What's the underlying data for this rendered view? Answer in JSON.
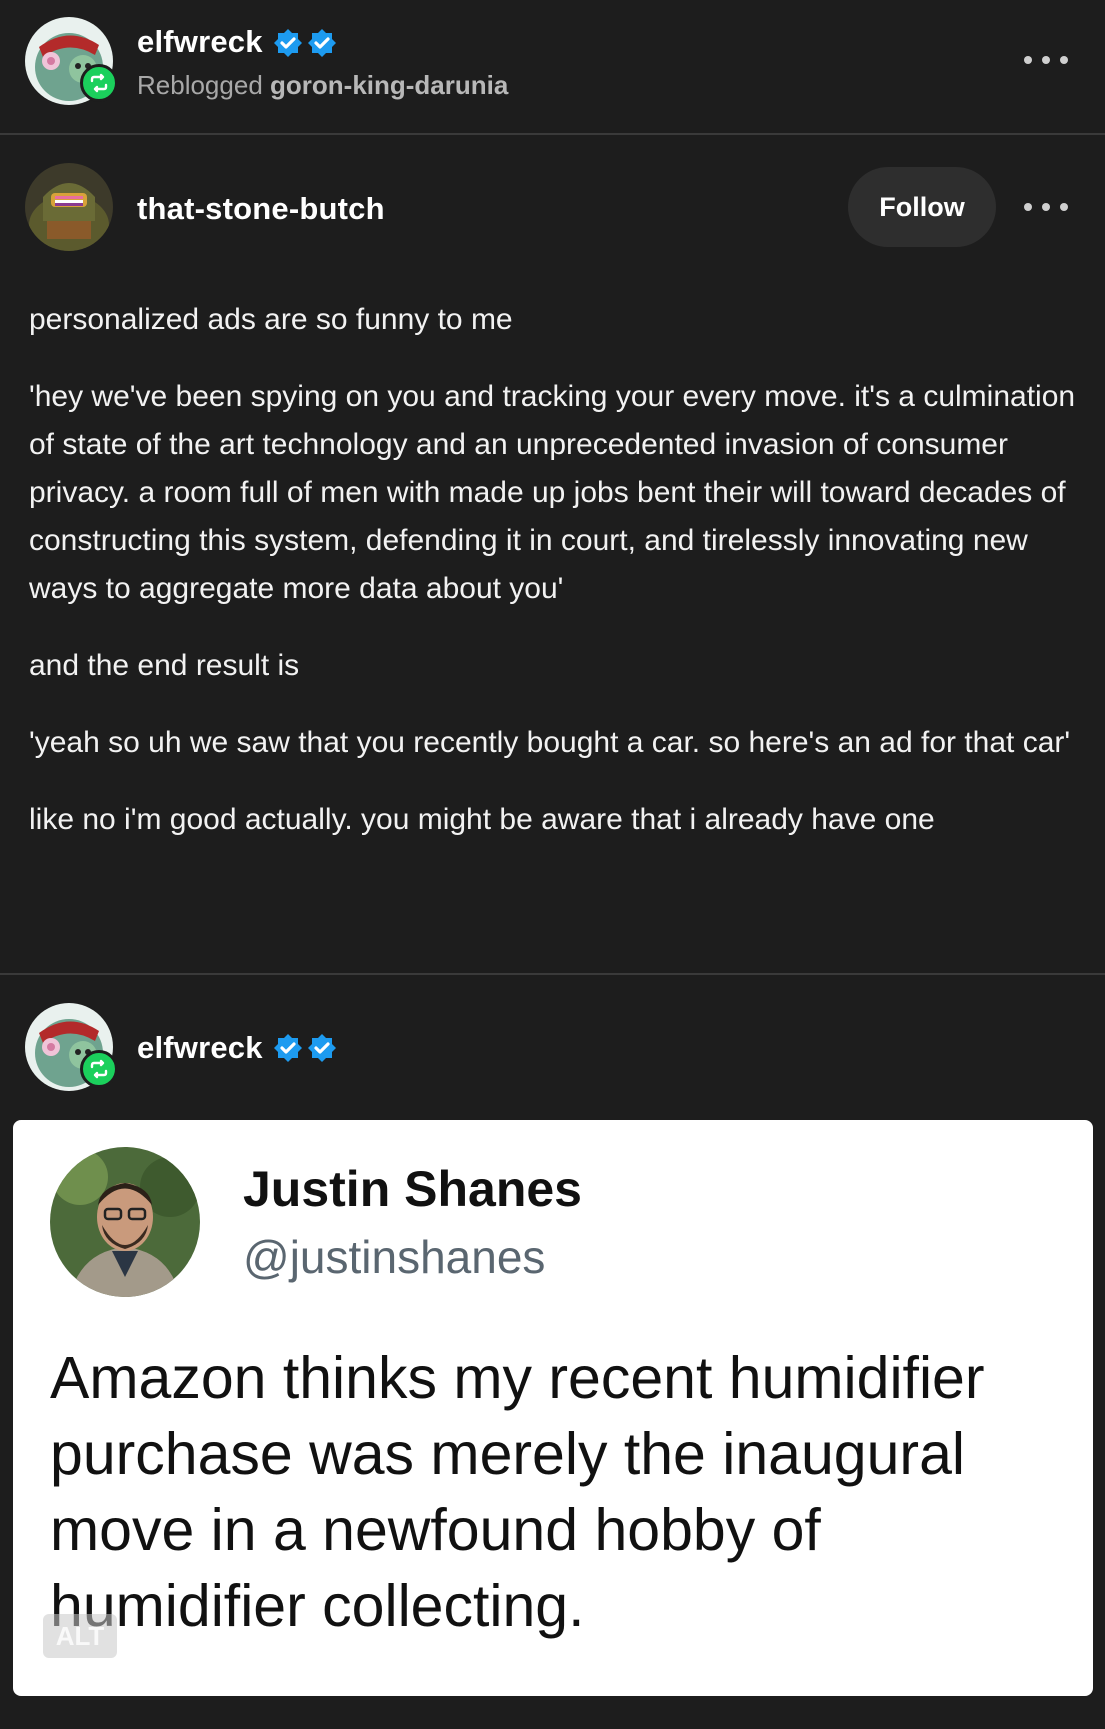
{
  "reblog_header": {
    "username": "elfwreck",
    "reblogged_prefix": "Reblogged",
    "reblogged_from": "goron-king-darunia",
    "more_icon": "more-dots-icon"
  },
  "original_post": {
    "username": "that-stone-butch",
    "follow_label": "Follow",
    "more_icon": "more-dots-icon",
    "paragraphs": [
      "personalized ads are so funny to me",
      "'hey we've been spying on you and tracking your every move. it's a culmination of state of the art technology and an unprecedented invasion of consumer privacy. a room full of men with made up jobs bent their will toward decades of constructing this system, defending it in court, and tirelessly innovating new ways to aggregate more data about you'",
      "and the end result is",
      "'yeah so uh we saw that you recently bought a car. so here's an ad for that car'",
      "like no i'm good actually. you might be aware that i already have one"
    ]
  },
  "reblog_post": {
    "username": "elfwreck",
    "tweet": {
      "name": "Justin Shanes",
      "handle": "@justinshanes",
      "text": "Amazon thinks my recent humidifier purchase was merely the inaugural move in a newfound hobby of humidifier collecting."
    },
    "alt_label": "ALT"
  },
  "colors": {
    "background": "#1d1d1d",
    "reblog_green": "#1bd05c",
    "verified_blue": "#1d9bf0",
    "follow_button_bg": "#2e2e2e"
  }
}
